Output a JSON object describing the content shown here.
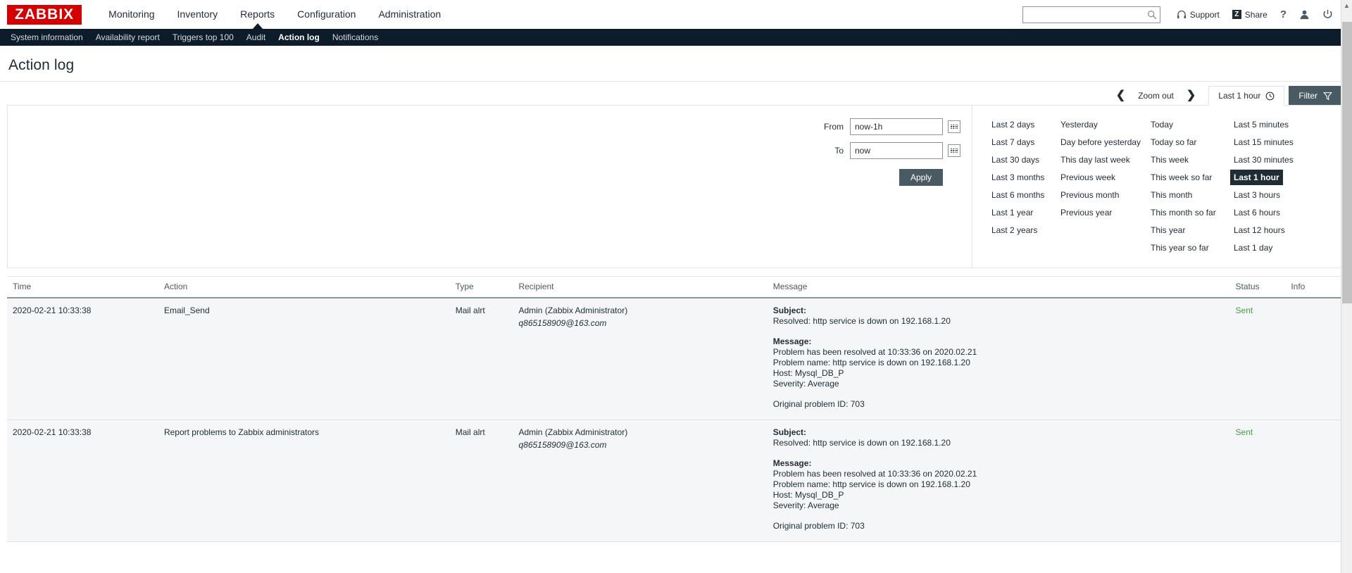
{
  "app": {
    "logo": "ZABBIX",
    "page_title": "Action log"
  },
  "mainmenu": {
    "items": [
      {
        "label": "Monitoring",
        "selected": false
      },
      {
        "label": "Inventory",
        "selected": false
      },
      {
        "label": "Reports",
        "selected": true
      },
      {
        "label": "Configuration",
        "selected": false
      },
      {
        "label": "Administration",
        "selected": false
      }
    ]
  },
  "submenu": {
    "items": [
      {
        "label": "System information",
        "selected": false
      },
      {
        "label": "Availability report",
        "selected": false
      },
      {
        "label": "Triggers top 100",
        "selected": false
      },
      {
        "label": "Audit",
        "selected": false
      },
      {
        "label": "Action log",
        "selected": true
      },
      {
        "label": "Notifications",
        "selected": false
      }
    ]
  },
  "topright": {
    "search_value": "",
    "search_placeholder": "",
    "support_label": "Support",
    "share_label": "Share",
    "share_badge": "Z",
    "help_label": "?",
    "user_label": "",
    "signout_label": ""
  },
  "timecontrol": {
    "prev_arrow": "❮",
    "zoom_out_label": "Zoom out",
    "next_arrow": "❯",
    "active_tab_label": "Last 1 hour",
    "clock_icon": "clock-icon",
    "filter_label": "Filter"
  },
  "filter": {
    "from_label": "From",
    "from_value": "now-1h",
    "to_label": "To",
    "to_value": "now",
    "apply_label": "Apply",
    "ranges": [
      [
        {
          "label": "Last 2 days",
          "selected": false
        },
        {
          "label": "Last 7 days",
          "selected": false
        },
        {
          "label": "Last 30 days",
          "selected": false
        },
        {
          "label": "Last 3 months",
          "selected": false
        },
        {
          "label": "Last 6 months",
          "selected": false
        },
        {
          "label": "Last 1 year",
          "selected": false
        },
        {
          "label": "Last 2 years",
          "selected": false
        }
      ],
      [
        {
          "label": "Yesterday",
          "selected": false
        },
        {
          "label": "Day before yesterday",
          "selected": false
        },
        {
          "label": "This day last week",
          "selected": false
        },
        {
          "label": "Previous week",
          "selected": false
        },
        {
          "label": "Previous month",
          "selected": false
        },
        {
          "label": "Previous year",
          "selected": false
        }
      ],
      [
        {
          "label": "Today",
          "selected": false
        },
        {
          "label": "Today so far",
          "selected": false
        },
        {
          "label": "This week",
          "selected": false
        },
        {
          "label": "This week so far",
          "selected": false
        },
        {
          "label": "This month",
          "selected": false
        },
        {
          "label": "This month so far",
          "selected": false
        },
        {
          "label": "This year",
          "selected": false
        },
        {
          "label": "This year so far",
          "selected": false
        }
      ],
      [
        {
          "label": "Last 5 minutes",
          "selected": false
        },
        {
          "label": "Last 15 minutes",
          "selected": false
        },
        {
          "label": "Last 30 minutes",
          "selected": false
        },
        {
          "label": "Last 1 hour",
          "selected": true
        },
        {
          "label": "Last 3 hours",
          "selected": false
        },
        {
          "label": "Last 6 hours",
          "selected": false
        },
        {
          "label": "Last 12 hours",
          "selected": false
        },
        {
          "label": "Last 1 day",
          "selected": false
        }
      ]
    ]
  },
  "table": {
    "headers": [
      "Time",
      "Action",
      "Type",
      "Recipient",
      "Message",
      "Status",
      "Info"
    ],
    "rows": [
      {
        "time": "2020-02-21 10:33:38",
        "action": "Email_Send",
        "type": "Mail alrt",
        "recipient_name": "Admin (Zabbix Administrator)",
        "recipient_email": "q865158909@163.com",
        "subject_label": "Subject:",
        "subject_text": "Resolved: http service is down on 192.168.1.20",
        "message_label": "Message:",
        "message_lines": [
          "Problem has been resolved at 10:33:36 on 2020.02.21",
          "Problem name: http service is down on 192.168.1.20",
          "Host: Mysql_DB_P",
          "Severity: Average"
        ],
        "original_problem": "Original problem ID: 703",
        "status": "Sent",
        "status_color": "#45a045",
        "info": ""
      },
      {
        "time": "2020-02-21 10:33:38",
        "action": "Report problems to Zabbix administrators",
        "type": "Mail alrt",
        "recipient_name": "Admin (Zabbix Administrator)",
        "recipient_email": "q865158909@163.com",
        "subject_label": "Subject:",
        "subject_text": "Resolved: http service is down on 192.168.1.20",
        "message_label": "Message:",
        "message_lines": [
          "Problem has been resolved at 10:33:36 on 2020.02.21",
          "Problem name: http service is down on 192.168.1.20",
          "Host: Mysql_DB_P",
          "Severity: Average"
        ],
        "original_problem": "Original problem ID: 703",
        "status": "Sent",
        "status_color": "#45a045",
        "info": ""
      }
    ]
  }
}
